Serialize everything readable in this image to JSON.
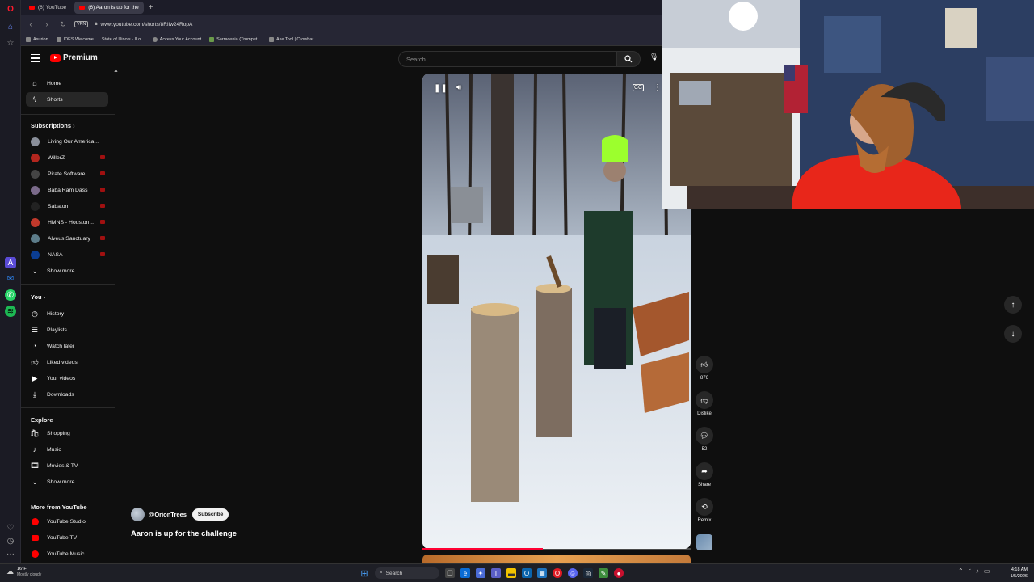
{
  "browser": {
    "tabs": [
      {
        "label": "(6) YouTube",
        "active": false
      },
      {
        "label": "(6) Aaron is up for the",
        "active": true
      }
    ],
    "vpn_badge": "VPN",
    "url": "www.youtube.com/shorts/8RIlw24RopA",
    "bookmarks": [
      "Asurion",
      "IDES Welcome",
      "State of Illinois - ILo...",
      "Access Your Account",
      "Sarracenia (Trumpet...",
      "Axe Tool | Crowbar..."
    ]
  },
  "header": {
    "logo_text": "Premium",
    "search_placeholder": "Search"
  },
  "sidebar": {
    "main_items": [
      "Home",
      "Shorts"
    ],
    "subscriptions_title": "Subscriptions",
    "subscriptions": [
      {
        "name": "Living Our America...",
        "color": "#8a8f9a",
        "live": false
      },
      {
        "name": "WillerZ",
        "color": "#b3261e",
        "live": true
      },
      {
        "name": "Pirate Software",
        "color": "#444444",
        "live": true
      },
      {
        "name": "Baba Ram Dass",
        "color": "#7a6a8a",
        "live": true
      },
      {
        "name": "Sabaton",
        "color": "#222222",
        "live": true
      },
      {
        "name": "HMNS - Houston...",
        "color": "#c0392b",
        "live": true
      },
      {
        "name": "Alveus Sanctuary",
        "color": "#5d7d8a",
        "live": true
      },
      {
        "name": "NASA",
        "color": "#0b3d91",
        "live": true
      }
    ],
    "show_more_1": "Show more",
    "you_title": "You",
    "you_items": [
      "History",
      "Playlists",
      "Watch later",
      "Liked videos",
      "Your videos",
      "Downloads"
    ],
    "explore_title": "Explore",
    "explore_items": [
      "Shopping",
      "Music",
      "Movies & TV"
    ],
    "show_more_2": "Show more",
    "more_title": "More from YouTube",
    "more_items": [
      "YouTube Studio",
      "YouTube TV",
      "YouTube Music"
    ]
  },
  "short": {
    "channel": "@OrionTrees",
    "subscribe_label": "Subscribe",
    "title": "Aaron is up for the challenge",
    "likes": "876",
    "dislike_label": "Dislike",
    "comments": "52",
    "share_label": "Share",
    "remix_label": "Remix",
    "progress": 0.45
  },
  "taskbar": {
    "temp": "16°F",
    "weather": "Mostly cloudy",
    "search_label": "Search",
    "time": "4:18 AM",
    "date": "1/5/2026"
  },
  "colors": {
    "brand_red": "#ff0000",
    "progress_red": "#ff0033",
    "bg": "#0f0f0f"
  }
}
